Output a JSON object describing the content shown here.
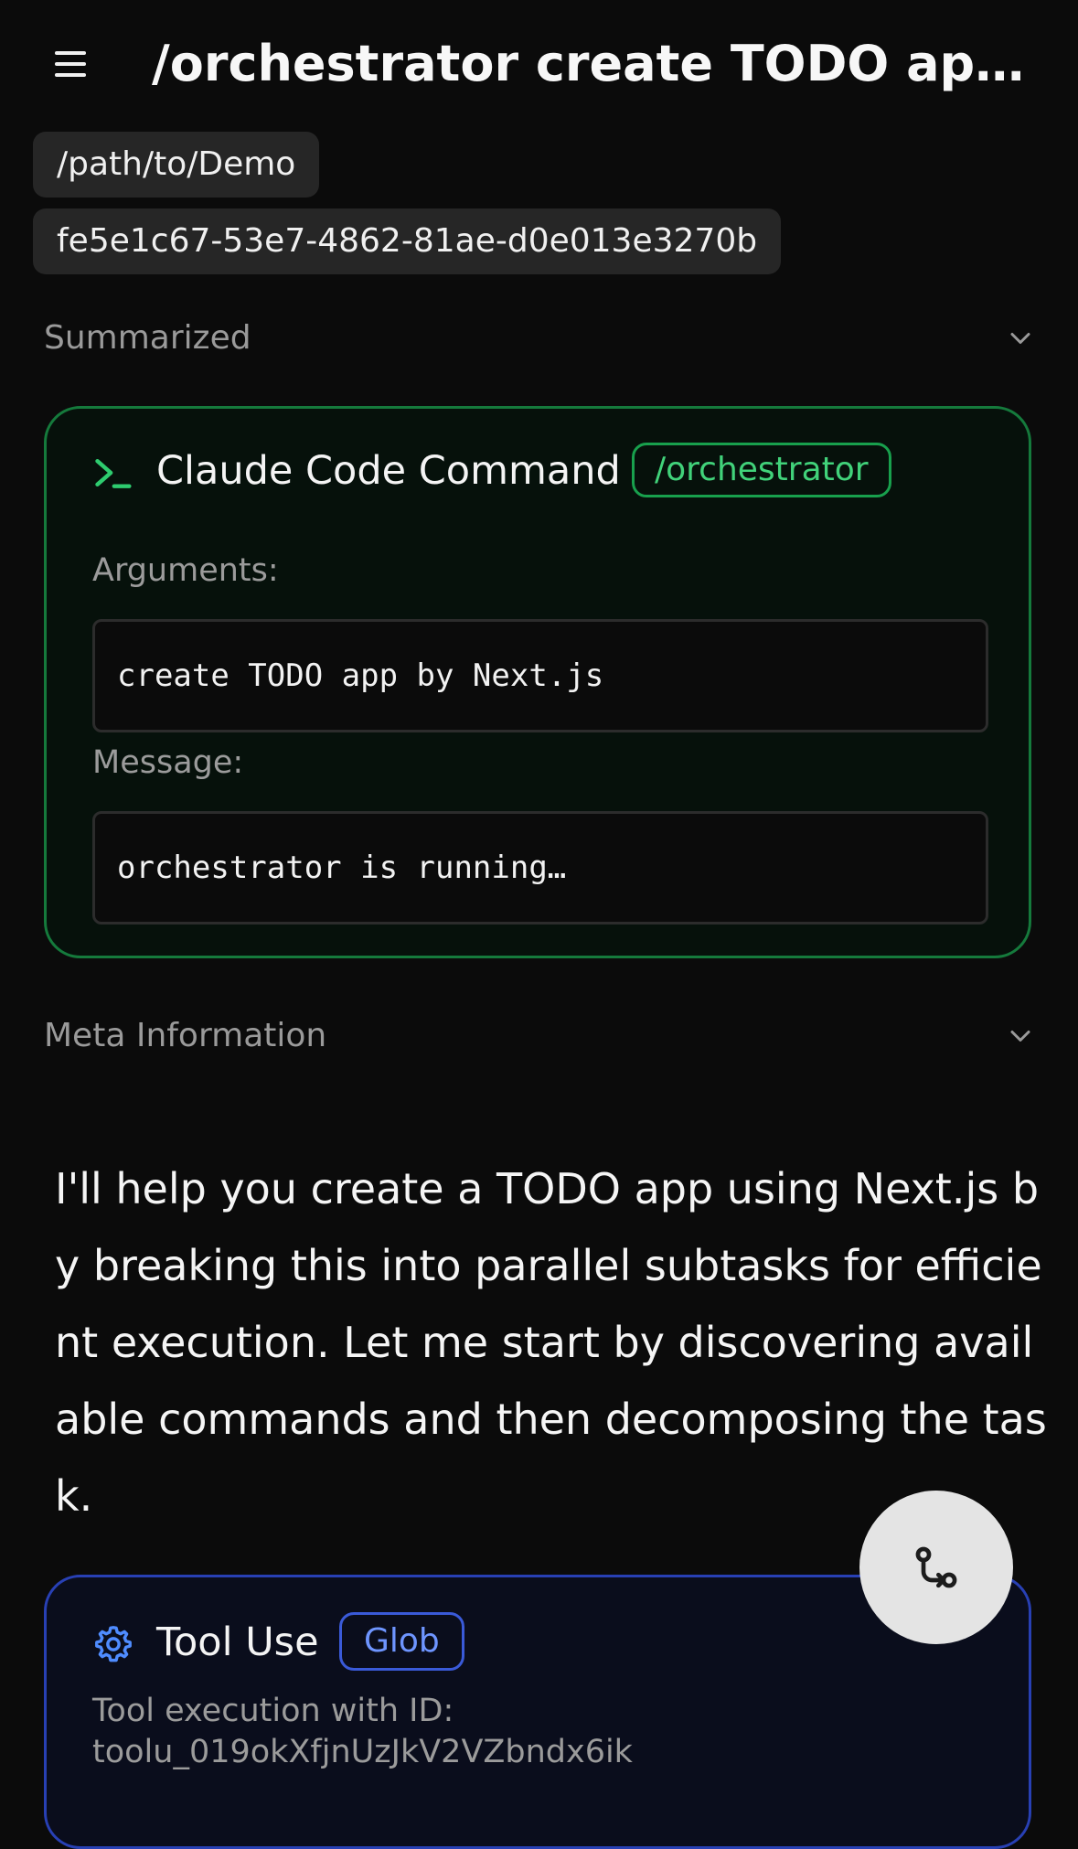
{
  "header": {
    "title": "/orchestrator create TODO app by Next.js"
  },
  "chips": {
    "path": "/path/to/Demo",
    "session_id": "fe5e1c67-53e7-4862-81ae-d0e013e3270b"
  },
  "sections": {
    "summarized": "Summarized",
    "meta": "Meta Information"
  },
  "command_card": {
    "title": "Claude Code Command",
    "badge": "/orchestrator",
    "arguments_label": "Arguments:",
    "arguments_value": "create TODO app by Next.js",
    "message_label": "Message:",
    "message_value": "orchestrator is running…",
    "accent": "#157a3c",
    "accent_text": "#41d27a"
  },
  "assistant_message": "I'll help you create a TODO app using Next.js by breaking this into parallel subtasks for efficient execution. Let me start by discovering available commands and then decomposing the task.",
  "tool_card": {
    "title": "Tool Use",
    "badge": "Glob",
    "description_line1": "Tool execution with ID:",
    "description_line2": "toolu_019okXfjnUzJkV2VZbndx6ik",
    "accent": "#2840b4",
    "accent_text": "#6e95ff"
  },
  "icons": {
    "menu": "menu-icon",
    "chevron": "chevron-down-icon",
    "terminal": "terminal-icon",
    "gear": "gear-icon",
    "git_compare": "git-compare-icon"
  }
}
